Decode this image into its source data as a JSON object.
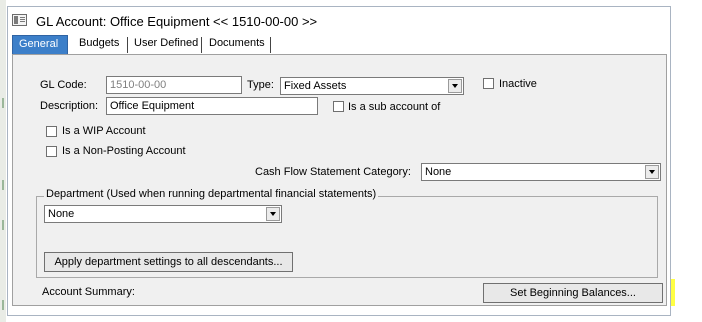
{
  "window": {
    "title": "GL Account: Office Equipment << 1510-00-00 >>"
  },
  "tabs": [
    {
      "label": "General",
      "active": true
    },
    {
      "label": "Budgets"
    },
    {
      "label": "User Defined"
    },
    {
      "label": "Documents"
    }
  ],
  "form": {
    "gl_code_label": "GL Code:",
    "gl_code_value": "1510-00-00",
    "type_label": "Type:",
    "type_value": "Fixed Assets",
    "inactive_label": "Inactive",
    "description_label": "Description:",
    "description_value": "Office Equipment",
    "sub_account_label": "Is a sub account of",
    "wip_label": "Is a WIP Account",
    "non_posting_label": "Is a Non-Posting Account",
    "cash_flow_label": "Cash Flow Statement Category:",
    "cash_flow_value": "None"
  },
  "department": {
    "group_title": "Department (Used when running departmental financial statements)",
    "value": "None",
    "apply_button": "Apply department settings to all descendants..."
  },
  "footer": {
    "account_summary_label": "Account Summary:",
    "set_balances_button": "Set Beginning Balances..."
  },
  "colors": {
    "active_tab": "#3c7fc9",
    "highlight": "#ffff44",
    "panel": "#f0f0f0"
  }
}
